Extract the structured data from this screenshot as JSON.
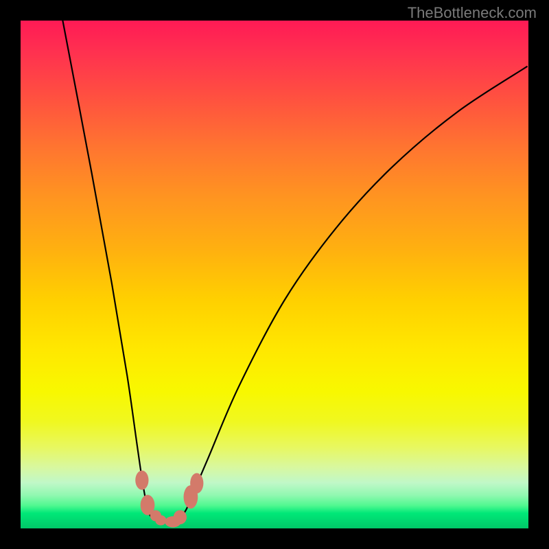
{
  "watermark": "TheBottleneck.com",
  "chart_data": {
    "type": "line",
    "title": "",
    "xlabel": "",
    "ylabel": "",
    "xlim": [
      0,
      100
    ],
    "ylim": [
      0,
      100
    ],
    "curve": {
      "name": "bottleneck-curve",
      "points": [
        [
          8.2,
          100.5
        ],
        [
          14.0,
          70.0
        ],
        [
          18.0,
          48.0
        ],
        [
          21.0,
          30.0
        ],
        [
          23.0,
          16.0
        ],
        [
          24.2,
          8.0
        ],
        [
          25.3,
          3.0
        ],
        [
          27.0,
          1.3
        ],
        [
          29.0,
          1.2
        ],
        [
          30.8,
          1.5
        ],
        [
          32.5,
          3.5
        ],
        [
          34.0,
          7.0
        ],
        [
          37.0,
          14.0
        ],
        [
          43.0,
          28.0
        ],
        [
          52.0,
          45.0
        ],
        [
          62.0,
          59.0
        ],
        [
          73.0,
          71.0
        ],
        [
          86.0,
          82.0
        ],
        [
          99.8,
          91.0
        ]
      ]
    },
    "markers": [
      {
        "x": 23.9,
        "y": 9.5,
        "rx": 1.3,
        "ry": 1.9
      },
      {
        "x": 25.0,
        "y": 4.6,
        "rx": 1.4,
        "ry": 2.0
      },
      {
        "x": 26.6,
        "y": 2.5,
        "rx": 1.1,
        "ry": 1.1
      },
      {
        "x": 27.6,
        "y": 1.6,
        "rx": 1.1,
        "ry": 1.0
      },
      {
        "x": 30.0,
        "y": 1.3,
        "rx": 1.6,
        "ry": 1.1
      },
      {
        "x": 31.4,
        "y": 2.2,
        "rx": 1.3,
        "ry": 1.4
      },
      {
        "x": 33.5,
        "y": 6.2,
        "rx": 1.4,
        "ry": 2.3
      },
      {
        "x": 34.7,
        "y": 8.9,
        "rx": 1.3,
        "ry": 2.0
      }
    ],
    "gradient_stops": [
      {
        "pos": 0,
        "color": "#ff1a55"
      },
      {
        "pos": 20,
        "color": "#ff6a35"
      },
      {
        "pos": 45,
        "color": "#ffb010"
      },
      {
        "pos": 70,
        "color": "#f5f500"
      },
      {
        "pos": 90,
        "color": "#d0f8b0"
      },
      {
        "pos": 100,
        "color": "#00d870"
      }
    ],
    "marker_color": "#d37a6a"
  }
}
